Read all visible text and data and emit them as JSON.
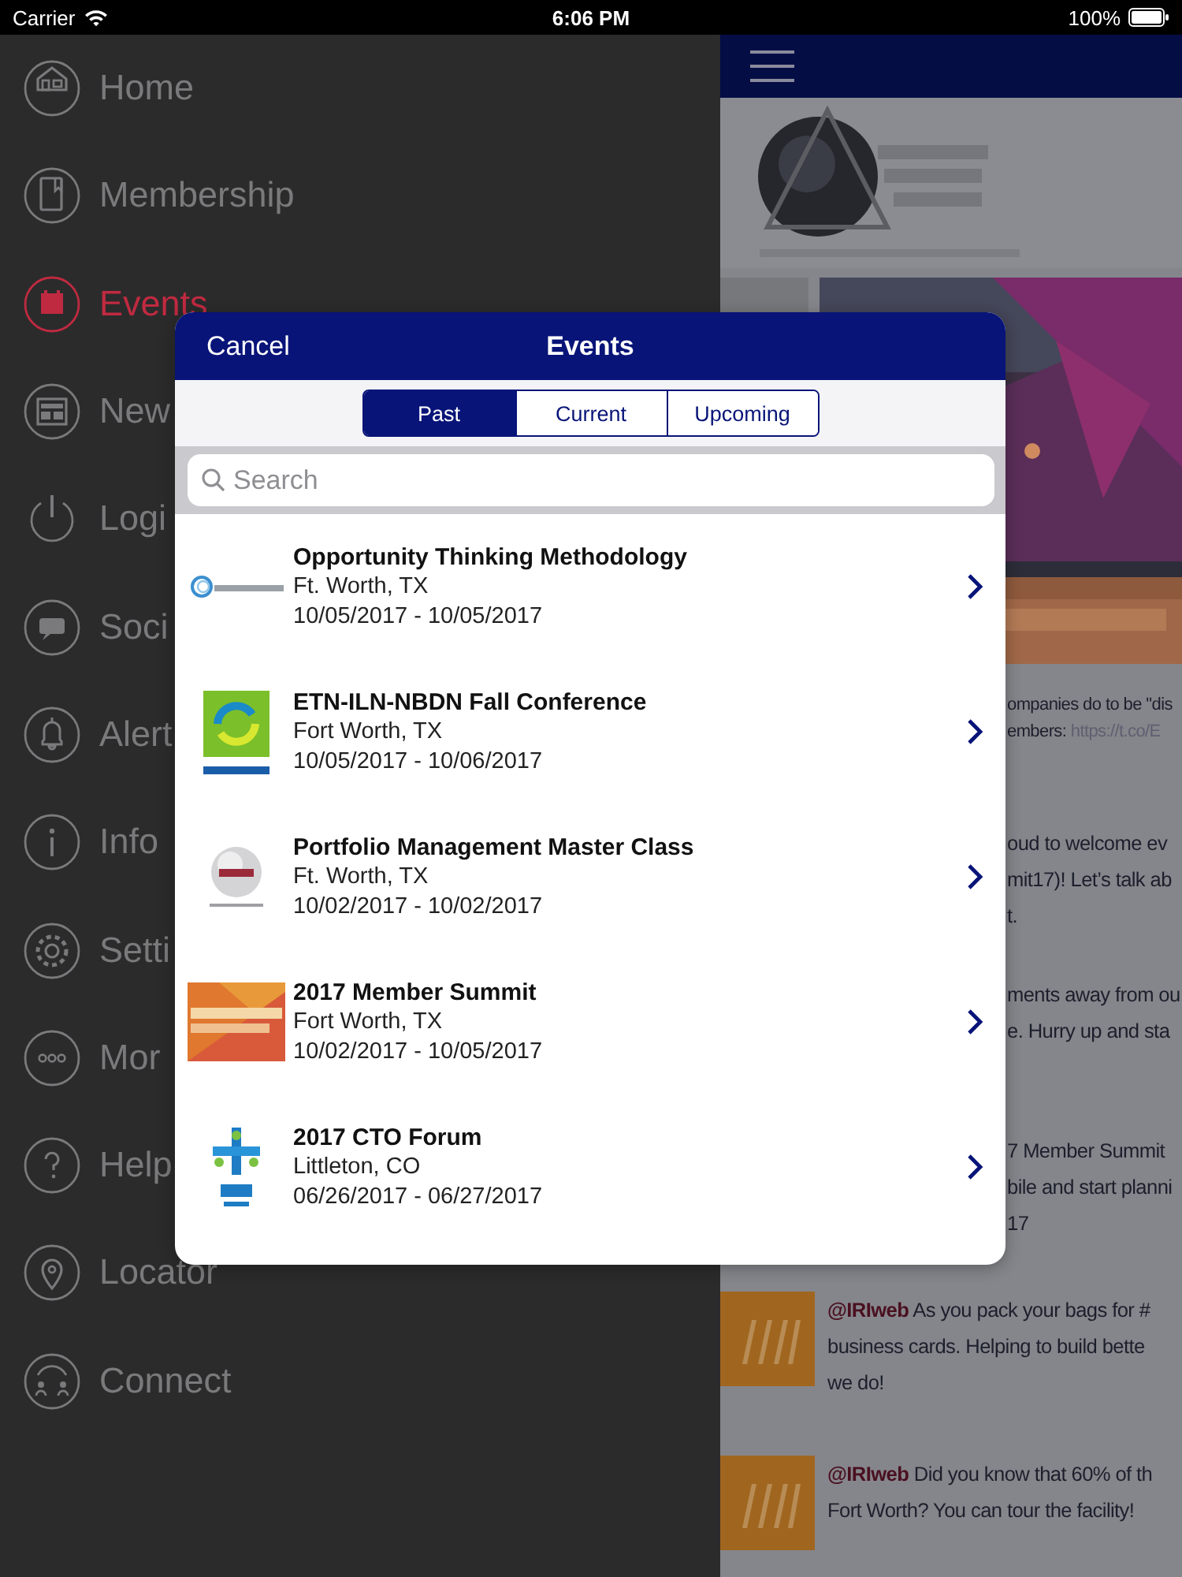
{
  "status_bar": {
    "carrier": "Carrier",
    "time": "6:06 PM",
    "battery": "100%"
  },
  "sidebar": {
    "items": [
      {
        "label": "Home",
        "selected": false
      },
      {
        "label": "Membership",
        "selected": false
      },
      {
        "label": "Events",
        "selected": true
      },
      {
        "label": "New",
        "selected": false
      },
      {
        "label": "Logi",
        "selected": false
      },
      {
        "label": "Soci",
        "selected": false
      },
      {
        "label": "Alert",
        "selected": false
      },
      {
        "label": "Info",
        "selected": false
      },
      {
        "label": "Setti",
        "selected": false
      },
      {
        "label": "Mor",
        "selected": false
      },
      {
        "label": "Help",
        "selected": false
      },
      {
        "label": "Locator",
        "selected": false
      },
      {
        "label": "Connect",
        "selected": false
      }
    ]
  },
  "feed": {
    "tweets": [
      {
        "text": "ompanies do to be \"dis\nembers: ",
        "link": "https://t.co/E"
      },
      {
        "text": "oud to welcome ev\nmit17)! Let’s talk ab\nt."
      },
      {
        "text": "ments away from ou\ne. Hurry up and sta"
      },
      {
        "text": "7 Member Summit\nbile and start planni\n17"
      },
      {
        "handle": "@IRIweb",
        "text": " As you pack your bags for #\nbusiness cards. Helping to build bette\nwe do!"
      },
      {
        "handle": "@IRIweb",
        "text": " Did you know that 60% of th\nFort Worth? You can tour the facility!"
      }
    ]
  },
  "modal": {
    "cancel": "Cancel",
    "title": "Events",
    "tabs": [
      {
        "label": "Past",
        "selected": true
      },
      {
        "label": "Current",
        "selected": false
      },
      {
        "label": "Upcoming",
        "selected": false
      }
    ],
    "search": {
      "placeholder": "Search"
    },
    "events": [
      {
        "title": "Opportunity Thinking Methodology",
        "location": "Ft. Worth, TX",
        "dates": "10/05/2017 - 10/05/2017"
      },
      {
        "title": "ETN-ILN-NBDN Fall Conference",
        "location": "Fort Worth, TX",
        "dates": "10/05/2017 - 10/06/2017"
      },
      {
        "title": "Portfolio Management Master Class",
        "location": "Ft. Worth, TX",
        "dates": "10/02/2017 - 10/02/2017"
      },
      {
        "title": "2017 Member Summit",
        "location": "Fort Worth, TX",
        "dates": "10/02/2017 - 10/05/2017"
      },
      {
        "title": "2017 CTO Forum",
        "location": "Littleton, CO",
        "dates": "06/26/2017 - 06/27/2017"
      }
    ]
  }
}
